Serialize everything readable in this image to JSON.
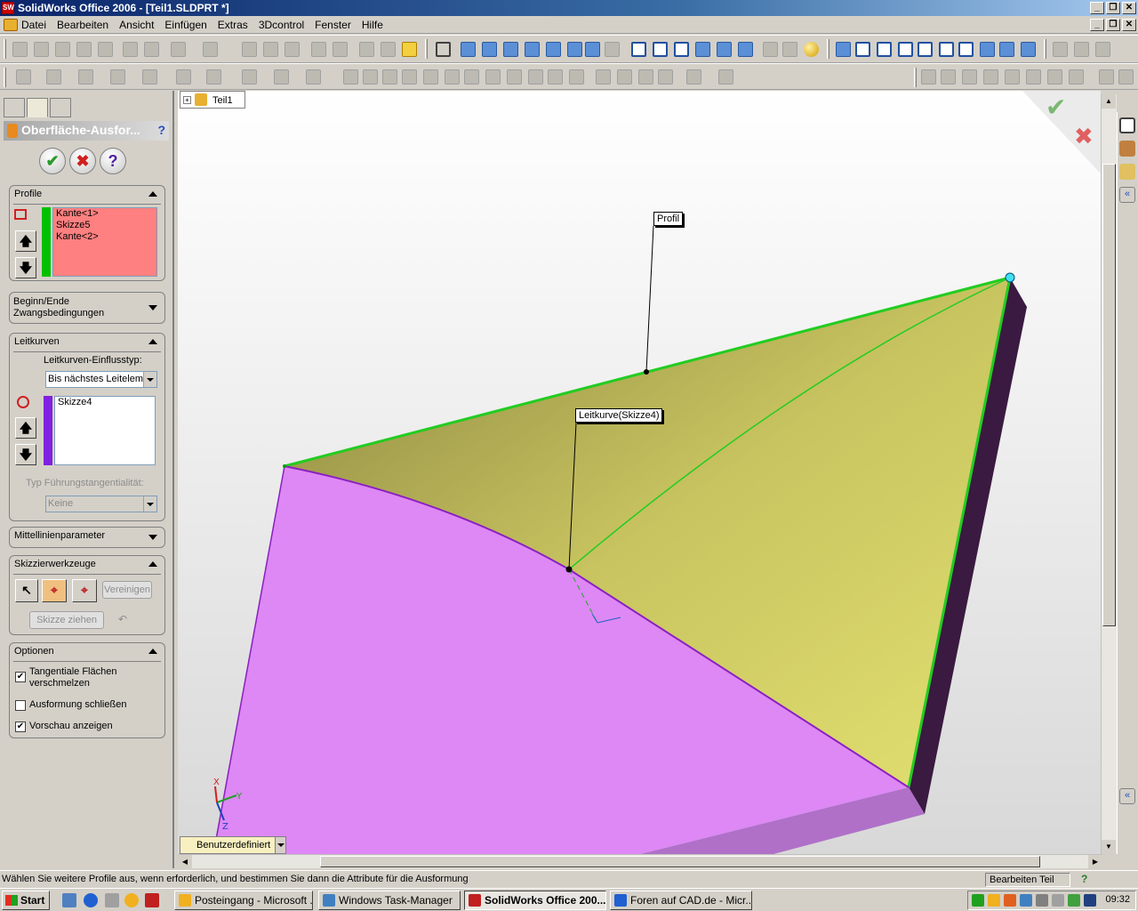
{
  "window": {
    "title": "SolidWorks Office 2006 - [Teil1.SLDPRT *]",
    "app_icon_label": "SW"
  },
  "menu": {
    "items": [
      "Datei",
      "Bearbeiten",
      "Ansicht",
      "Einfügen",
      "Extras",
      "3Dcontrol",
      "Fenster",
      "Hilfe"
    ]
  },
  "property_manager": {
    "title": "Oberfläche-Ausfor...",
    "help_glyph": "?",
    "ok_glyph": "✔",
    "cancel_glyph": "✖",
    "help_btn_glyph": "?",
    "profile": {
      "title": "Profile",
      "items": [
        "Kante<1>",
        "Skizze5",
        "Kante<2>"
      ],
      "bar_color": "#00c000",
      "list_color": "#ff8080"
    },
    "constraints": {
      "title_line1": "Beginn/Ende",
      "title_line2": "Zwangsbedingungen"
    },
    "guides": {
      "title": "Leitkurven",
      "influence_label": "Leitkurven-Einflusstyp:",
      "influence_value": "Bis nächstes Leitelement",
      "items": [
        "Skizze4"
      ],
      "bar_color": "#8020e0",
      "tangency_label": "Typ Führungstangentialität:",
      "tangency_value": "Keine"
    },
    "centerline": {
      "title": "Mittellinienparameter"
    },
    "sketch_tools": {
      "title": "Skizzierwerkzeuge",
      "merge_label": "Vereinigen",
      "drag_label": "Skizze ziehen"
    },
    "options": {
      "title": "Optionen",
      "merge_tangent_line1": "Tangentiale Flächen",
      "merge_tangent_line2": "verschmelzen",
      "merge_tangent_checked": "✔",
      "close_loft": "Ausformung schließen",
      "close_loft_checked": "",
      "show_preview": "Vorschau anzeigen",
      "show_preview_checked": "✔"
    },
    "arrows": {
      "up": "🡅",
      "down": "🡇"
    }
  },
  "graphics": {
    "tree_root": "Teil1",
    "tree_expand": "+",
    "callout_profile": "Profil",
    "callout_guide": "Leitkurve(Skizze4)",
    "view_orientation": "Benutzerdefiniert",
    "triad": {
      "x": "X",
      "y": "Y",
      "z": "Z"
    },
    "colors": {
      "surface_yellow": "#d8d66a",
      "surface_magenta": "#dd88f5",
      "edge_green": "#22cc22",
      "edge_purple": "#8a20c0",
      "side_dark": "#3a1a40"
    }
  },
  "status": {
    "message": "Wählen Sie weitere Profile aus, wenn erforderlich, und bestimmen Sie dann die Attribute für die Ausformung",
    "mode": "Bearbeiten Teil",
    "help": "?"
  },
  "taskbar": {
    "start": "Start",
    "tasks": [
      {
        "label": "Posteingang - Microsoft ...",
        "active": false
      },
      {
        "label": "Windows Task-Manager",
        "active": false
      },
      {
        "label": "SolidWorks Office 200...",
        "active": true
      },
      {
        "label": "Foren auf CAD.de - Micr...",
        "active": false
      }
    ],
    "clock": "09:32"
  }
}
